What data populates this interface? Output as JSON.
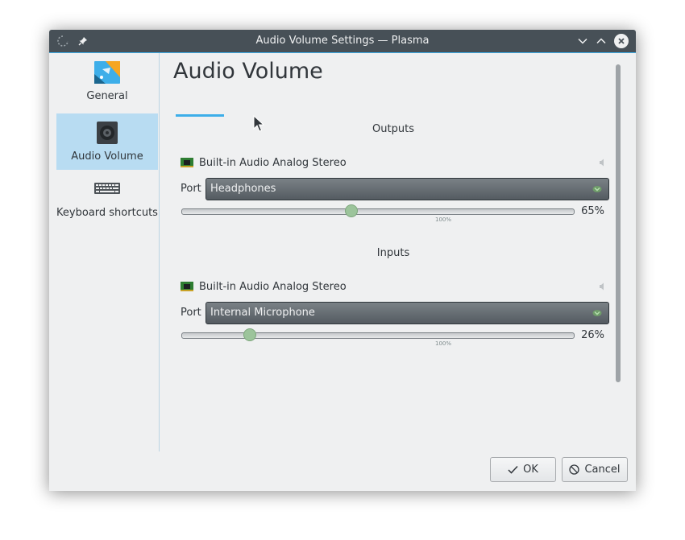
{
  "window": {
    "title": "Audio Volume Settings — Plasma"
  },
  "sidebar": {
    "items": [
      {
        "label": "General",
        "icon": "general-settings-icon"
      },
      {
        "label": "Audio Volume",
        "icon": "speaker-icon",
        "selected": true
      },
      {
        "label": "Keyboard shortcuts",
        "icon": "keyboard-icon"
      }
    ]
  },
  "main": {
    "title": "Audio Volume",
    "outputs": {
      "section_label": "Outputs",
      "device_name": "Built-in Audio Analog Stereo",
      "port_label": "Port",
      "port_value": "Headphones",
      "volume_text": "65%",
      "volume_fraction": 0.65,
      "mark_label": "100%"
    },
    "inputs": {
      "section_label": "Inputs",
      "device_name": "Built-in Audio Analog Stereo",
      "port_label": "Port",
      "port_value": "Internal Microphone",
      "volume_text": "26%",
      "volume_fraction": 0.26,
      "mark_label": "100%"
    }
  },
  "buttons": {
    "ok": "OK",
    "cancel": "Cancel"
  },
  "colors": {
    "accent": "#3daee9",
    "titlebar": "#475057",
    "selection": "#b8dcf2",
    "slider_handle": "#9cc49b"
  }
}
